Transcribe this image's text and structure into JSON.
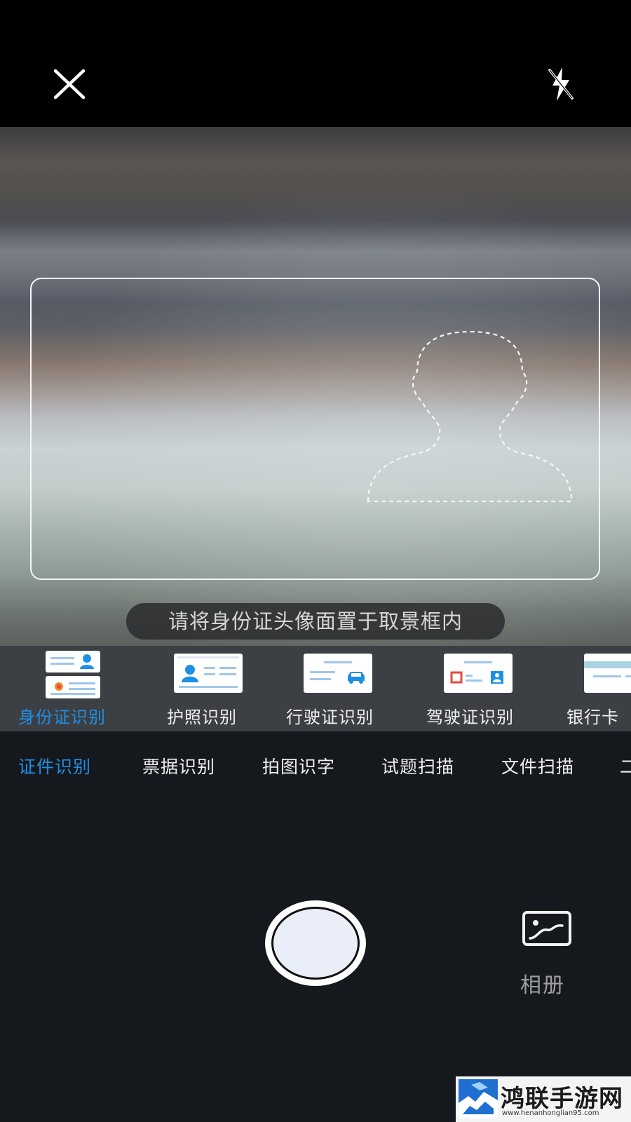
{
  "viewfinder": {
    "hint": "请将身份证头像面置于取景框内"
  },
  "doc_types": [
    {
      "label": "身份证识别",
      "icon": "id-card-icon",
      "active": true
    },
    {
      "label": "护照识别",
      "icon": "passport-icon",
      "active": false
    },
    {
      "label": "行驶证识别",
      "icon": "vehicle-license-icon",
      "active": false
    },
    {
      "label": "驾驶证识别",
      "icon": "driver-license-icon",
      "active": false
    },
    {
      "label": "银行卡",
      "icon": "bank-card-icon",
      "active": false
    }
  ],
  "modes": [
    {
      "label": "证件识别",
      "active": true
    },
    {
      "label": "票据识别",
      "active": false
    },
    {
      "label": "拍图识字",
      "active": false
    },
    {
      "label": "试题扫描",
      "active": false
    },
    {
      "label": "文件扫描",
      "active": false
    },
    {
      "label": "二",
      "active": false
    }
  ],
  "controls": {
    "album_label": "相册"
  },
  "watermark": {
    "title": "鸿联手游网",
    "url": "www.henanhonglian95.com"
  },
  "colors": {
    "accent": "#1e8fe6",
    "background": "#15181c",
    "strip": "#3c3f43"
  }
}
